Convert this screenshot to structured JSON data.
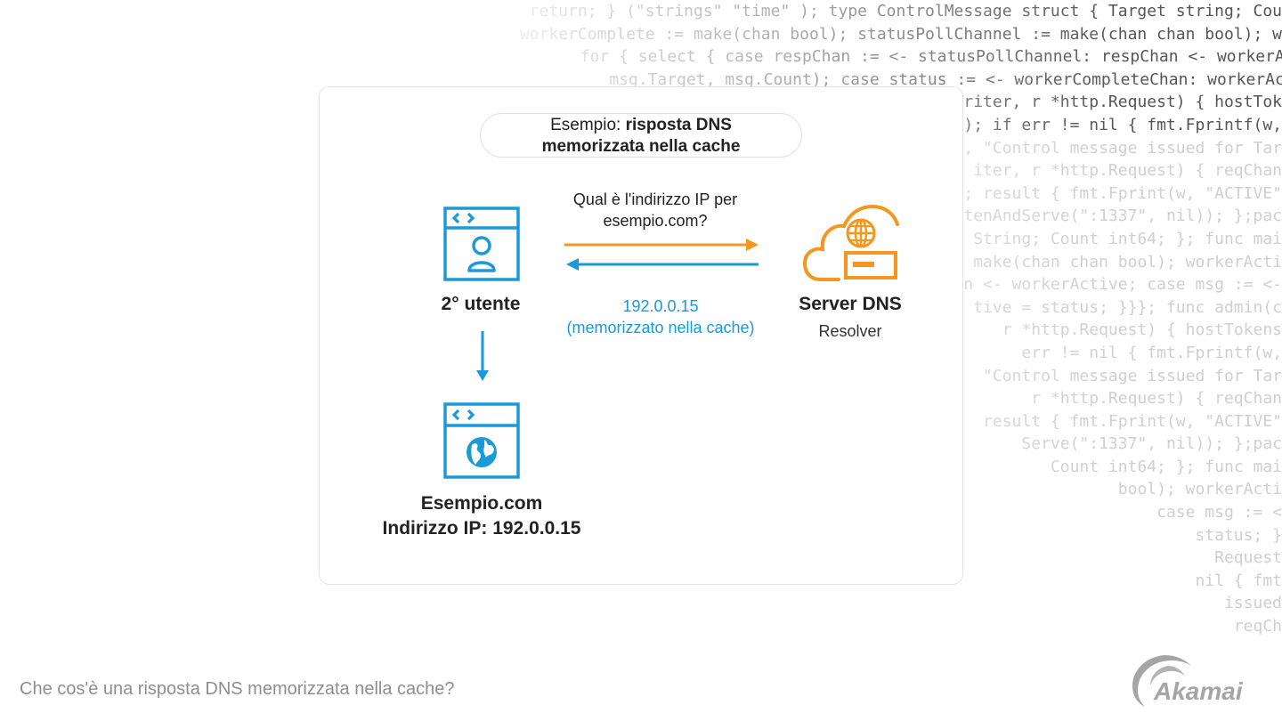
{
  "background_code": [
    "        return; } (\"strings\" \"time\" ); type ControlMessage struct { Target string; Cou",
    "       workerComplete := make(chan bool); statusPollChannel := make(chan chan bool); w",
    "              for { select { case respChan := <- statusPollChannel: respChan <- workerActive; case",
    "                 msg.Target, msg.Count); case status := <- workerCompleteChan: workerActive = status;",
    "                                                 Writer, r *http.Request) { hostTok",
    "                                                 ); if err != nil { fmt.Fprintf(w,",
    "                                                 w, \"Control message issued for Tar",
    "                                                 iter, r *http.Request) { reqChan",
    "                                                 ; result { fmt.Fprint(w, \"ACTIVE\"",
    "                                                 tenAndServe(\":1337\", nil)); };pac",
    "                                                 String; Count int64; }; func mai",
    "                                                 = make(chan chan bool); workerActi",
    "                                                 n <- workerActive; case msg := <-",
    "                                                 tive = status; }}}; func admin(c",
    "                                                 r *http.Request) { hostTokens",
    "                                                  err != nil { fmt.Fprintf(w,",
    "                                                  \"Control message issued for Tar",
    "                                                 r *http.Request) { reqChan",
    "                                                  result { fmt.Fprint(w, \"ACTIVE\"",
    "                                                   Serve(\":1337\", nil)); };pac",
    "                                                      Count int64; }; func mai",
    "                                                         bool); workerActi",
    "                                                               case msg := <",
    "                                                                   status; }",
    "                                                                    Request",
    "                                                                   nil { fmt",
    "                                                                     issued",
    "                                                                      reqCh"
  ],
  "diagram": {
    "title_prefix": "Esempio: ",
    "title_bold": "risposta DNS memorizzata nella cache",
    "query_text": "Qual è l'indirizzo IP per esempio.com?",
    "response_ip": "192.0.0.15",
    "response_note": "(memorizzato nella cache)",
    "user_label": "2° utente",
    "server_label": "Server DNS",
    "server_sublabel": "Resolver",
    "site_name": "Esempio.com",
    "site_ip": "Indirizzo IP: 192.0.0.15"
  },
  "colors": {
    "blue": "#1a9ad6",
    "orange": "#f5961e",
    "text": "#222222",
    "caption": "#8e8e8e"
  },
  "footer": {
    "caption": "Che cos'è una risposta DNS memorizzata nella cache?",
    "logo_text": "Akamai"
  }
}
